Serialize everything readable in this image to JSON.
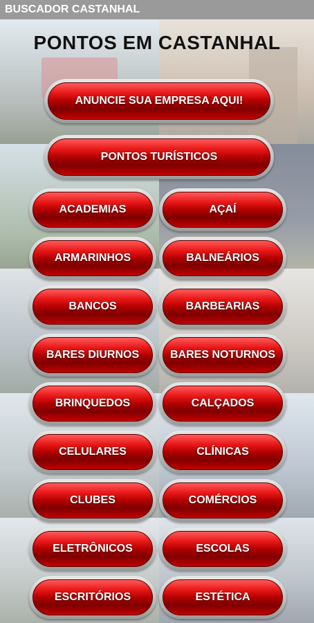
{
  "app_bar": {
    "title": "BUSCADOR CASTANHAL"
  },
  "page": {
    "title": "PONTOS EM CASTANHAL"
  },
  "buttons": {
    "advertise": "ANUNCIE SUA EMPRESA AQUI!",
    "tourism": "PONTOS TURÍSTICOS"
  },
  "categories": [
    "ACADEMIAS",
    "AÇAÍ",
    "ARMARINHOS",
    "BALNEÁRIOS",
    "BANCOS",
    "BARBEARIAS",
    "BARES DIURNOS",
    "BARES NOTURNOS",
    "BRINQUEDOS",
    "CALÇADOS",
    "CELULARES",
    "CLÍNICAS",
    "CLUBES",
    "COMÉRCIOS",
    "ELETRÔNICOS",
    "ESCOLAS",
    "ESCRITÓRIOS",
    "ESTÉTICA"
  ]
}
